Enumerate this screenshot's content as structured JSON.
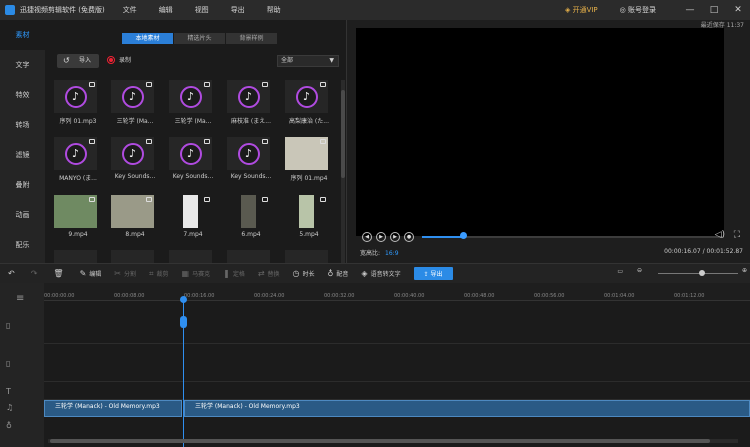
{
  "app": {
    "title": "迅捷视频剪辑软件 (免费版)"
  },
  "menu": [
    "文件",
    "编辑",
    "视图",
    "导出",
    "帮助"
  ],
  "topbar": {
    "vip": "开通VIP",
    "login": "账号登录"
  },
  "sidebar": [
    "素材",
    "文字",
    "特效",
    "转场",
    "滤镜",
    "叠附",
    "动画",
    "配乐"
  ],
  "tabs": [
    "本地素材",
    "精选片头",
    "背景样例"
  ],
  "panel": {
    "import": "导入",
    "record": "录制",
    "filter": "全部"
  },
  "media": [
    {
      "name": "序列 01.mp3",
      "kind": "music"
    },
    {
      "name": "三轮学 (Ma...",
      "kind": "music"
    },
    {
      "name": "三轮学 (Ma...",
      "kind": "music"
    },
    {
      "name": "麻枝准 (まえ...",
      "kind": "music"
    },
    {
      "name": "高梨康治 (た...",
      "kind": "music"
    },
    {
      "name": "MANYO (ま...",
      "kind": "music"
    },
    {
      "name": "Key Sounds...",
      "kind": "music"
    },
    {
      "name": "Key Sounds...",
      "kind": "music"
    },
    {
      "name": "Key Sounds...",
      "kind": "music"
    },
    {
      "name": "序列 01.mp4",
      "kind": "video"
    },
    {
      "name": "9.mp4",
      "kind": "video"
    },
    {
      "name": "8.mp4",
      "kind": "video"
    },
    {
      "name": "7.mp4",
      "kind": "tall"
    },
    {
      "name": "6.mp4",
      "kind": "tall"
    },
    {
      "name": "5.mp4",
      "kind": "tall"
    }
  ],
  "preview": {
    "save_time": "最近保存 11:37",
    "ratio_label": "宽高比:",
    "ratio_value": "16:9",
    "time": "00:00:16.07 / 00:01:52.87",
    "progress": 0.14
  },
  "toolbar": {
    "edit": "编辑",
    "split": "分割",
    "crop": "裁剪",
    "mosaic": "马赛克",
    "freeze": "定格",
    "replace": "替换",
    "duration": "时长",
    "dub": "配音",
    "speech": "语音转文字",
    "export": "导出"
  },
  "ruler": [
    "00:00:00.00",
    "00:00:08.00",
    "00:00:16.00",
    "00:00:24.00",
    "00:00:32.00",
    "00:00:40.00",
    "00:00:48.00",
    "00:00:56.00",
    "00:01:04.00",
    "00:01:12.00"
  ],
  "clips": [
    "三轮学 (Manack) - Old Memory.mp3",
    "三轮学 (Manack) - Old Memory.mp3"
  ],
  "icons": [
    "undo-icon",
    "redo-icon",
    "delete-icon",
    "import-icon",
    "record-icon",
    "music-note-icon",
    "play-icon",
    "volume-icon",
    "fullscreen-icon",
    "zoom-out-icon",
    "zoom-in-icon"
  ]
}
